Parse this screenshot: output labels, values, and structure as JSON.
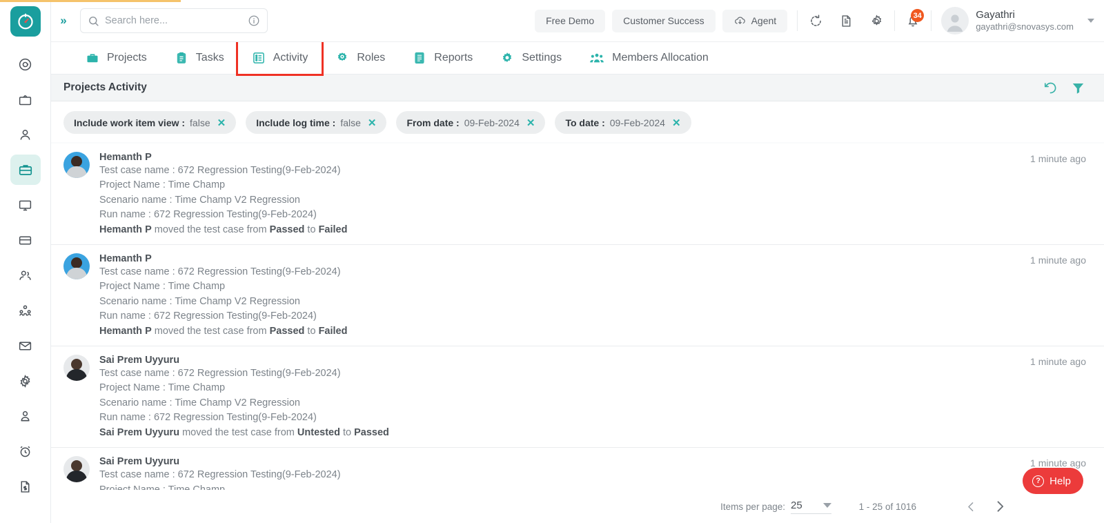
{
  "brand": {
    "accent": "#1a9e9e",
    "accent_light": "#2bb3ab",
    "highlight_box": "#ef3124",
    "badge_color": "#f0581f",
    "help_color": "#ec3b3b"
  },
  "header": {
    "collapse_icon": "chevrons-right-icon",
    "search": {
      "placeholder": "Search here...",
      "value": "",
      "icon": "search-icon",
      "info_icon": "info-circle-icon"
    },
    "buttons": [
      {
        "label": "Free Demo",
        "icon": null
      },
      {
        "label": "Customer Success",
        "icon": null
      },
      {
        "label": "Agent",
        "icon": "cloud-download-icon"
      }
    ],
    "icons": [
      {
        "name": "refresh-icon"
      },
      {
        "name": "document-icon"
      },
      {
        "name": "gear-icon"
      },
      {
        "name": "bell-icon",
        "badge": "34"
      }
    ],
    "user": {
      "name": "Gayathri",
      "email": "gayathri@snovasys.com",
      "avatar": "user-avatar",
      "caret": "chevron-down-icon"
    }
  },
  "sidebar": {
    "logo": "timechamp-clock-logo",
    "items": [
      {
        "name": "sidebar-item-activity-tracker",
        "icon": "spiral-icon",
        "active": false
      },
      {
        "name": "sidebar-item-screen-recording",
        "icon": "tv-icon",
        "active": false
      },
      {
        "name": "sidebar-item-profile",
        "icon": "user-icon",
        "active": false
      },
      {
        "name": "sidebar-item-projects",
        "icon": "briefcase-icon",
        "active": true
      },
      {
        "name": "sidebar-item-desktop",
        "icon": "monitor-icon",
        "active": false
      },
      {
        "name": "sidebar-item-billing",
        "icon": "credit-card-icon",
        "active": false
      },
      {
        "name": "sidebar-item-teams",
        "icon": "users-icon",
        "active": false
      },
      {
        "name": "sidebar-item-organization",
        "icon": "org-chart-icon",
        "active": false
      },
      {
        "name": "sidebar-item-mail",
        "icon": "envelope-icon",
        "active": false
      },
      {
        "name": "sidebar-item-settings",
        "icon": "gear-icon",
        "active": false
      },
      {
        "name": "sidebar-item-account",
        "icon": "person-badge-icon",
        "active": false
      },
      {
        "name": "sidebar-item-timesheet",
        "icon": "alarm-clock-icon",
        "active": false
      },
      {
        "name": "sidebar-item-invoices",
        "icon": "file-dollar-icon",
        "active": false
      }
    ]
  },
  "nav": {
    "tabs": [
      {
        "label": "Projects",
        "icon": "briefcase-icon",
        "highlighted": false
      },
      {
        "label": "Tasks",
        "icon": "clipboard-icon",
        "highlighted": false
      },
      {
        "label": "Activity",
        "icon": "list-box-icon",
        "highlighted": true
      },
      {
        "label": "Roles",
        "icon": "target-gear-icon",
        "highlighted": false
      },
      {
        "label": "Reports",
        "icon": "report-icon",
        "highlighted": false
      },
      {
        "label": "Settings",
        "icon": "gear-icon",
        "highlighted": false
      },
      {
        "label": "Members Allocation",
        "icon": "people-group-icon",
        "highlighted": false
      }
    ]
  },
  "panel": {
    "title": "Projects Activity",
    "actions": [
      {
        "name": "reset-icon",
        "label": "reset"
      },
      {
        "name": "filter-funnel-icon",
        "label": "filter"
      }
    ],
    "chips": [
      {
        "label": "Include work item view :",
        "value": "false"
      },
      {
        "label": "Include log time :",
        "value": "false"
      },
      {
        "label": "From date :",
        "value": "09-Feb-2024"
      },
      {
        "label": "To date :",
        "value": "09-Feb-2024"
      }
    ]
  },
  "activities": [
    {
      "user": "Hemanth P",
      "time": "1 minute ago",
      "test_case": "Test case name : 672 Regression Testing(9-Feb-2024)",
      "project": "Project Name : Time Champ",
      "scenario": "Scenario name : Time Champ V2 Regression",
      "run": "Run name : 672 Regression Testing(9-Feb-2024)",
      "action_actor": "Hemanth P",
      "action_mid": " moved the test case from ",
      "action_from": "Passed",
      "action_to_word": " to ",
      "action_to": "Failed"
    },
    {
      "user": "Hemanth P",
      "time": "1 minute ago",
      "test_case": "Test case name : 672 Regression Testing(9-Feb-2024)",
      "project": "Project Name : Time Champ",
      "scenario": "Scenario name : Time Champ V2 Regression",
      "run": "Run name : 672 Regression Testing(9-Feb-2024)",
      "action_actor": "Hemanth P",
      "action_mid": " moved the test case from ",
      "action_from": "Passed",
      "action_to_word": " to ",
      "action_to": "Failed"
    },
    {
      "user": "Sai Prem Uyyuru",
      "time": "1 minute ago",
      "test_case": "Test case name : 672 Regression Testing(9-Feb-2024)",
      "project": "Project Name : Time Champ",
      "scenario": "Scenario name : Time Champ V2 Regression",
      "run": "Run name : 672 Regression Testing(9-Feb-2024)",
      "action_actor": "Sai Prem Uyyuru",
      "action_mid": " moved the test case from ",
      "action_from": "Untested",
      "action_to_word": " to ",
      "action_to": "Passed"
    },
    {
      "user": "Sai Prem Uyyuru",
      "time": "1 minute ago",
      "test_case": "Test case name : 672 Regression Testing(9-Feb-2024)",
      "project": "Project Name : Time Champ",
      "scenario": "",
      "run": "",
      "action_actor": "",
      "action_mid": "",
      "action_from": "",
      "action_to_word": "",
      "action_to": ""
    }
  ],
  "paginator": {
    "items_per_page_label": "Items per page:",
    "items_per_page_value": "25",
    "range": "1 - 25 of 1016",
    "prev_icon": "chevron-left-icon",
    "next_icon": "chevron-right-icon"
  },
  "help": {
    "label": "Help",
    "icon": "question-circle-icon"
  }
}
